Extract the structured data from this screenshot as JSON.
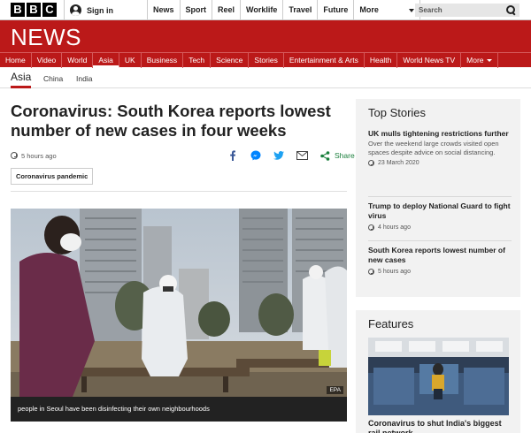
{
  "masthead": {
    "logo_letters": [
      "B",
      "B",
      "C"
    ],
    "signin_label": "Sign in",
    "nav": [
      "News",
      "Sport",
      "Reel",
      "Worklife",
      "Travel",
      "Future"
    ],
    "more_label": "More",
    "search_placeholder": "Search"
  },
  "section_header": {
    "title": "NEWS",
    "nav": [
      {
        "label": "Home",
        "active": false
      },
      {
        "label": "Video",
        "active": false
      },
      {
        "label": "World",
        "active": false
      },
      {
        "label": "Asia",
        "active": true
      },
      {
        "label": "UK",
        "active": false
      },
      {
        "label": "Business",
        "active": false
      },
      {
        "label": "Tech",
        "active": false
      },
      {
        "label": "Science",
        "active": false
      },
      {
        "label": "Stories",
        "active": false
      },
      {
        "label": "Entertainment & Arts",
        "active": false
      },
      {
        "label": "Health",
        "active": false
      },
      {
        "label": "World News TV",
        "active": false
      }
    ],
    "more_label": "More"
  },
  "subnav": {
    "current": "Asia",
    "items": [
      "China",
      "India"
    ]
  },
  "article": {
    "headline": "Coronavirus: South Korea reports lowest number of new cases in four weeks",
    "timestamp": "5 hours ago",
    "share_label": "Share",
    "share_icons": [
      "facebook-icon",
      "messenger-icon",
      "twitter-icon",
      "email-icon",
      "share-icon"
    ],
    "tag": "Coronavirus pandemic",
    "image_credit": "EPA",
    "caption": "people in Seoul have been disinfecting their own neighbourhoods"
  },
  "top_stories": {
    "title": "Top Stories",
    "items": [
      {
        "headline": "UK mulls tightening restrictions further",
        "summary": "Over the weekend large crowds visited open spaces despite advice on social distancing.",
        "time": "23 March 2020"
      },
      {
        "headline": "Trump to deploy National Guard to fight virus",
        "summary": "",
        "time": "4 hours ago"
      },
      {
        "headline": "South Korea reports lowest number of new cases",
        "summary": "",
        "time": "5 hours ago"
      }
    ]
  },
  "features": {
    "title": "Features",
    "headline": "Coronavirus to shut India's biggest rail network"
  },
  "colors": {
    "brand_red": "#bb1919",
    "share_green": "#1a7f3c",
    "facebook_blue": "#3b5998",
    "twitter_blue": "#1da1f2"
  }
}
